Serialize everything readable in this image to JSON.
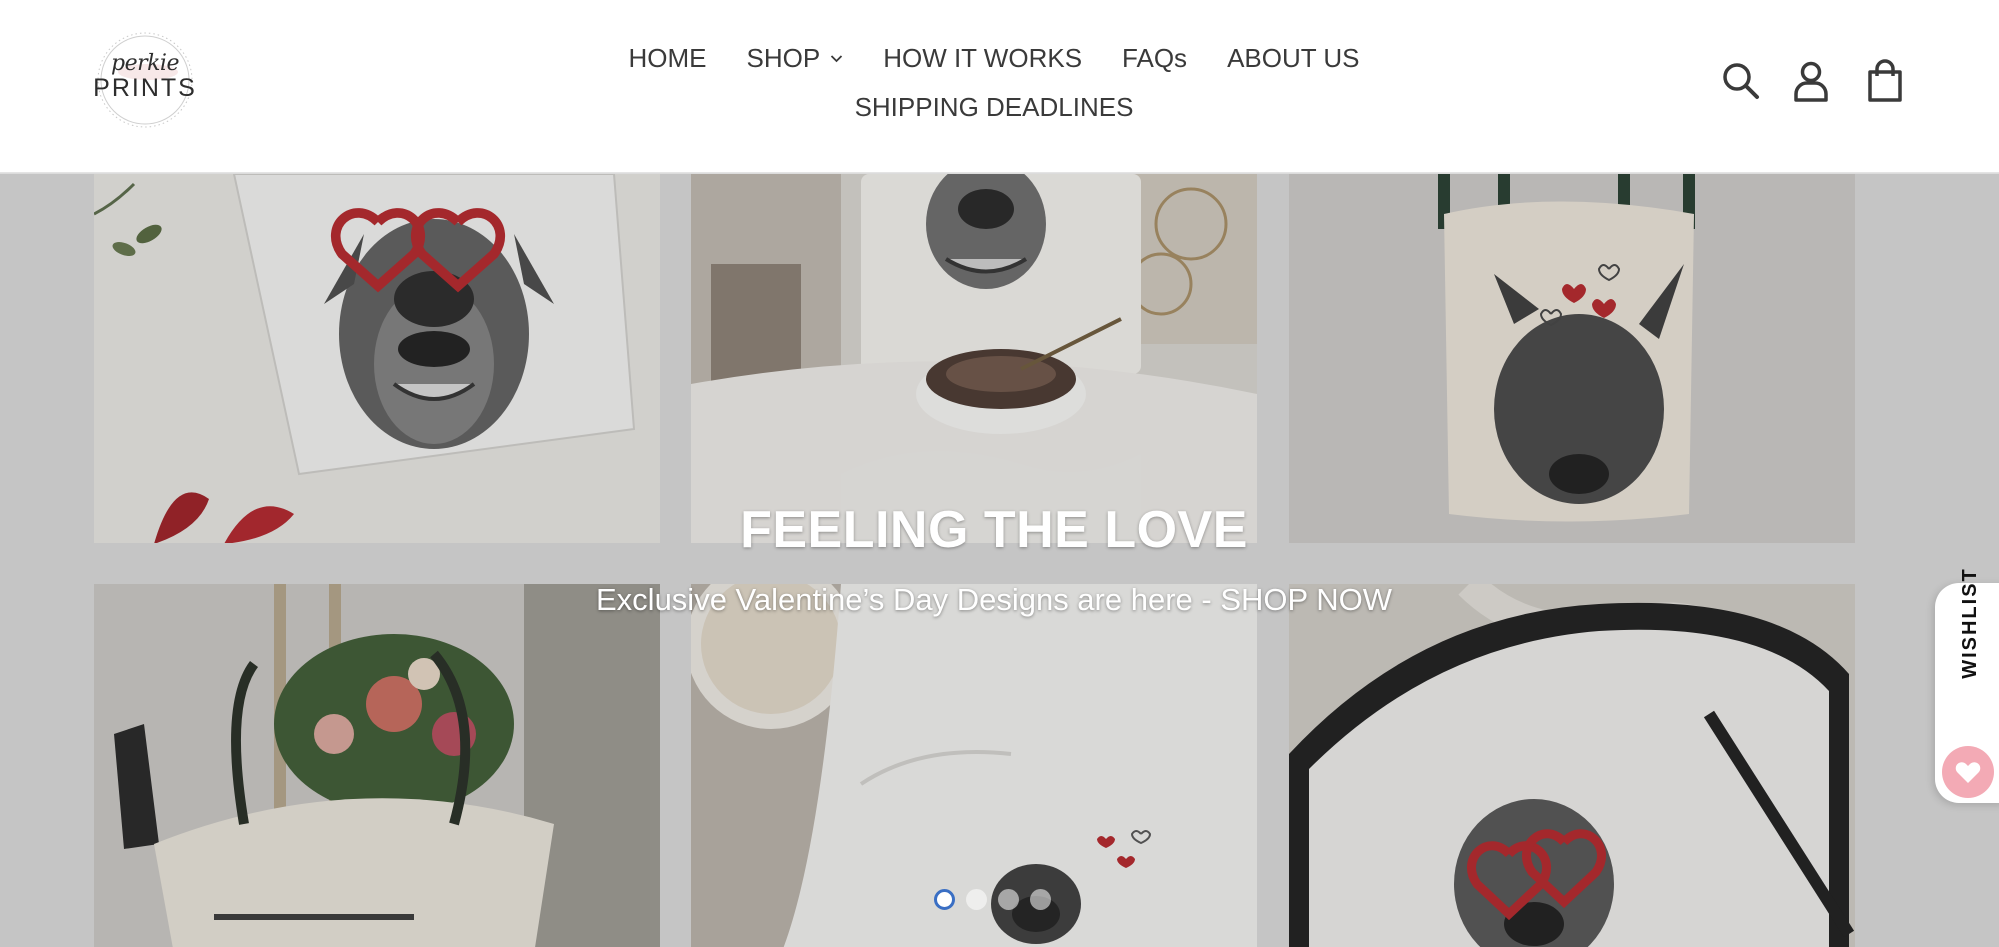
{
  "brand": {
    "logo_script": "perkie",
    "logo_main": "PRINTS"
  },
  "nav": {
    "row1": [
      {
        "label": "HOME"
      },
      {
        "label": "SHOP",
        "has_dropdown": true
      },
      {
        "label": "HOW IT WORKS"
      },
      {
        "label": "FAQs"
      },
      {
        "label": "ABOUT US"
      }
    ],
    "row2": [
      {
        "label": "SHIPPING DEADLINES"
      }
    ]
  },
  "header_icons": [
    "search-icon",
    "account-icon",
    "cart-icon"
  ],
  "hero": {
    "title": "FEELING THE LOVE",
    "subtitle": "Exclusive Valentine’s Day Designs are here - SHOP NOW",
    "slides_total": 4,
    "active_slide": 1
  },
  "wishlist": {
    "label": "WISHLIST",
    "heart_color": "#f3aab5"
  },
  "colors": {
    "header_bg": "#ffffff",
    "text": "#3a3a3a",
    "accent_red": "#b3262b",
    "active_dot_border": "#3a6fc4"
  }
}
